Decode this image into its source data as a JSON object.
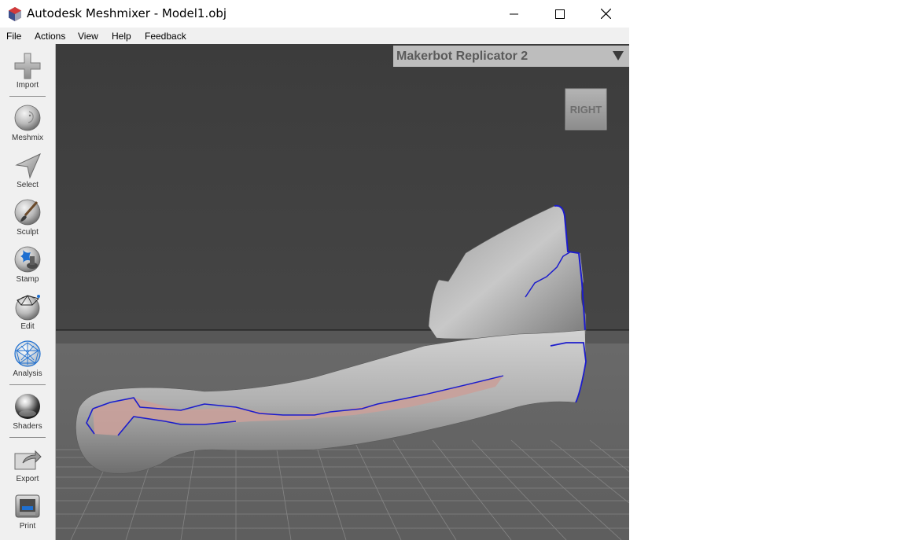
{
  "window": {
    "title": "Autodesk Meshmixer - Model1.obj"
  },
  "menu": {
    "items": [
      "File",
      "Actions",
      "View",
      "Help",
      "Feedback"
    ]
  },
  "toolbar": {
    "tools": [
      {
        "label": "Import",
        "icon": "plus-icon"
      },
      {
        "label": "Meshmix",
        "icon": "meshmix-sphere-icon"
      },
      {
        "label": "Select",
        "icon": "select-arrow-icon"
      },
      {
        "label": "Sculpt",
        "icon": "sculpt-brush-icon"
      },
      {
        "label": "Stamp",
        "icon": "stamp-icon"
      },
      {
        "label": "Edit",
        "icon": "edit-sphere-icon"
      },
      {
        "label": "Analysis",
        "icon": "analysis-mesh-icon"
      },
      {
        "label": "Shaders",
        "icon": "shaders-sphere-icon"
      },
      {
        "label": "Export",
        "icon": "export-icon"
      },
      {
        "label": "Print",
        "icon": "printer-icon"
      }
    ]
  },
  "viewport": {
    "printer": "Makerbot Replicator 2",
    "view_cube_label": "RIGHT"
  },
  "colors": {
    "background_upper": "#444444",
    "floor": "#686868",
    "mesh": "#b4b4b4",
    "selection_outline": "#1c1ccc",
    "selection_fill": "#c9a09a",
    "accent_blue": "#1e6fd0"
  }
}
